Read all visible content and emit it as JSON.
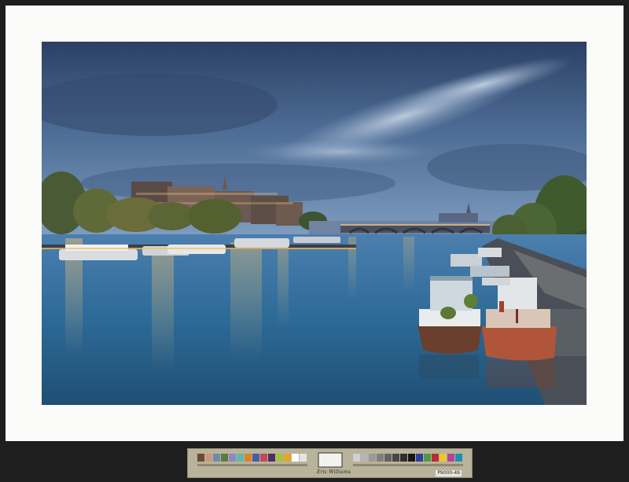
{
  "print": {
    "subject": "Seine river at dusk with moored houseboats, Paris",
    "colors": {
      "mat": "#fbfbf9",
      "frame": "#1e1e1e",
      "sky_top": "#2f4466",
      "sky_mid": "#56779f",
      "river": "#2f6f9a",
      "lamp_glow": "#f2b35a"
    }
  },
  "color_target": {
    "brand_text": "Eric Williams",
    "id_text": "P9000-49",
    "patches": [
      "#6b4a3a",
      "#c89a7c",
      "#6f88b0",
      "#5f7a3d",
      "#8a8bc1",
      "#5fb8a8",
      "#d9822b",
      "#4a5aa6",
      "#c24a55",
      "#4a2f63",
      "#a2c23a",
      "#e3a62a",
      "#ffffff",
      "#e4e4e4",
      "#cfcfcf",
      "#b5b5b5",
      "#9a9a9a",
      "#7e7e7e",
      "#626262",
      "#474747",
      "#2e2e2e",
      "#161616",
      "#2f3f9a",
      "#4c9a46",
      "#b82f35",
      "#e9c92c",
      "#b54495",
      "#1d8fb0"
    ]
  }
}
